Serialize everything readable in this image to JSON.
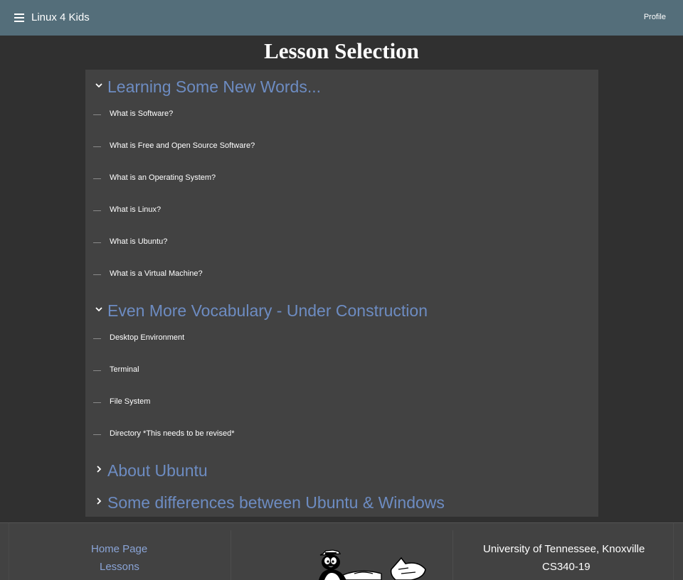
{
  "header": {
    "app_title": "Linux 4 Kids",
    "profile_label": "Profile"
  },
  "page_title": "Lesson Selection",
  "sections": [
    {
      "title": "Learning Some New Words...",
      "expanded": true,
      "items": [
        "What is Software?",
        "What is Free and Open Source Software?",
        "What is an Operating System?",
        "What is Linux?",
        "What is Ubuntu?",
        "What is a Virtual Machine?"
      ]
    },
    {
      "title": "Even More Vocabulary - Under Construction",
      "expanded": true,
      "items": [
        "Desktop Environment",
        "Terminal",
        "File System",
        "Directory *This needs to be revised*"
      ]
    },
    {
      "title": "About Ubuntu",
      "expanded": false,
      "items": []
    },
    {
      "title": "Some differences between Ubuntu & Windows",
      "expanded": false,
      "items": []
    }
  ],
  "footer": {
    "links": [
      "Home Page",
      "Lessons"
    ],
    "university": "University of Tennessee, Knoxville",
    "course": "CS340-19"
  },
  "colors": {
    "header_bg": "#546e7a",
    "page_bg": "#303030",
    "panel_bg": "#424242",
    "section_title": "#6d8cc2",
    "footer_link": "#8aa4d6"
  },
  "icons": {
    "menu": "hamburger-menu-icon",
    "expanded": "chevron-down-icon",
    "collapsed": "chevron-right-icon",
    "item": "dash-icon",
    "footer_logo": "tux-penguin-logo"
  }
}
